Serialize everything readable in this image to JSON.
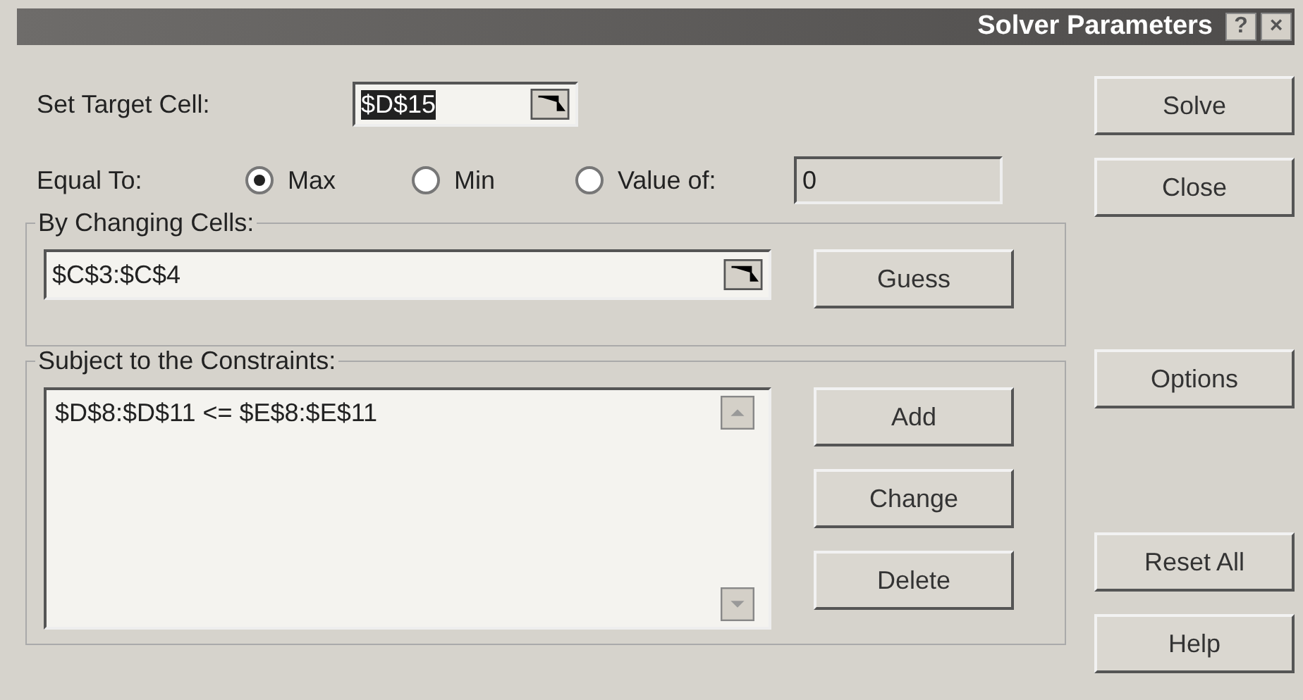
{
  "window": {
    "title": "Solver Parameters",
    "help_button": "?",
    "close_button": "×"
  },
  "target_cell": {
    "label": "Set Target Cell:",
    "value": "$D$15",
    "highlighted": true
  },
  "equal_to": {
    "label": "Equal To:",
    "value": "0",
    "options": [
      {
        "label": "Max",
        "selected": true
      },
      {
        "label": "Min",
        "selected": false
      },
      {
        "label": "Value of:",
        "selected": false
      }
    ]
  },
  "changing_cells": {
    "label": "By Changing Cells:",
    "value": "$C$3:$C$4",
    "button": "Guess"
  },
  "constraints": {
    "label": "Subject to the Constraints:",
    "items": [
      "$D$8:$D$11 <= $E$8:$E$11"
    ],
    "buttons": [
      "Add",
      "Change",
      "Delete"
    ]
  },
  "side_buttons": [
    "Solve",
    "Close",
    "Options",
    "Reset All",
    "Help"
  ]
}
